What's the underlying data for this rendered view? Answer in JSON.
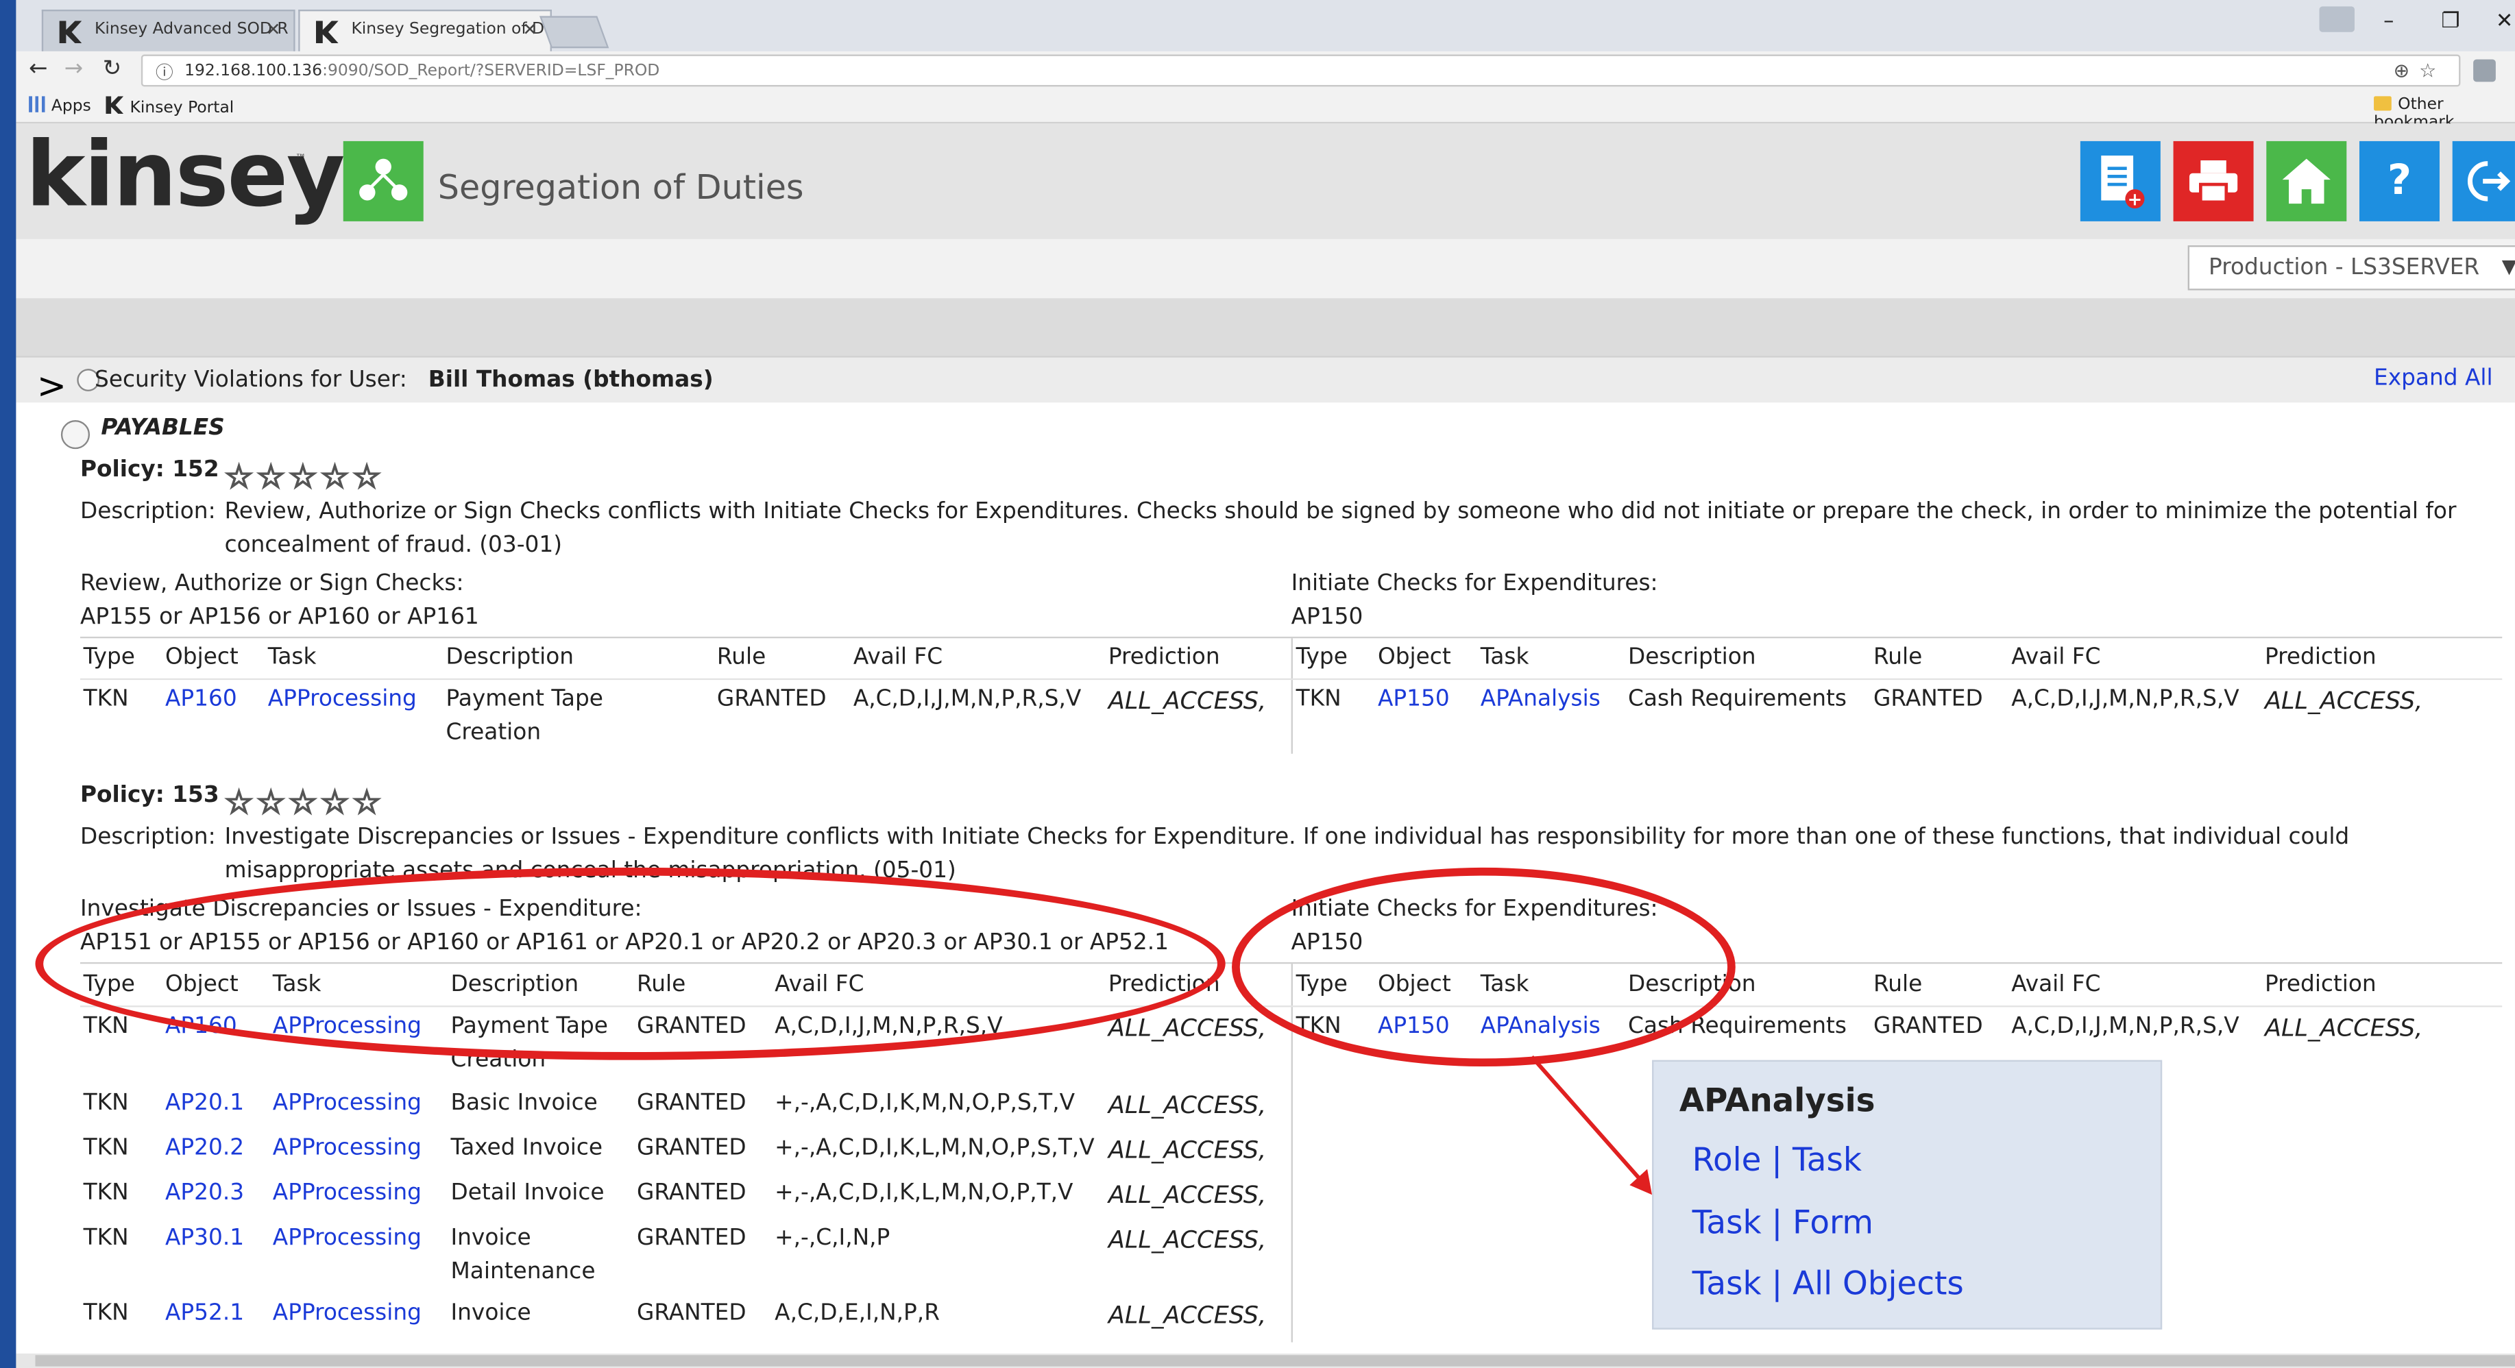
{
  "browser": {
    "tabs": [
      {
        "label": "Kinsey Advanced SOD R"
      },
      {
        "label": "Kinsey Segregation of D"
      }
    ],
    "url_host": "192.168.100.136",
    "url_path": ":9090/SOD_Report/?SERVERID=LSF_PROD",
    "bookmarks": [
      "Apps",
      "Kinsey Portal"
    ],
    "other_bookmarks": "Other bookmark"
  },
  "app": {
    "logo": "kinsey",
    "trademark": "™",
    "title": "Segregation of Duties",
    "environment": "Production - LS3SERVER",
    "toolbar": {
      "new": "+",
      "help": "?"
    },
    "colors": {
      "green": "#4bb84a",
      "blue": "#1e8fe0",
      "red": "#e02626",
      "highlight": "#e02020"
    }
  },
  "report": {
    "violations_label": "Security Violations for User:",
    "user": "Bill Thomas (bthomas)",
    "expand_all": "Expand All",
    "group": "PAYABLES",
    "desc_label": "Description:",
    "headers": [
      "Type",
      "Object",
      "Task",
      "Description",
      "Rule",
      "Avail FC",
      "Prediction"
    ],
    "policies": [
      {
        "label": "Policy: 152",
        "stars": "☆☆☆☆☆",
        "desc1": "Review, Authorize or Sign Checks conflicts with Initiate Checks for Expenditures. Checks should be signed by someone who did not initiate or prepare the check, in order to minimize the potential for",
        "desc2": "concealment of fraud. (03-01)",
        "left_func": "Review, Authorize or Sign Checks:",
        "left_objs": "AP155 or AP156 or AP160 or AP161",
        "right_func": "Initiate Checks for Expenditures:",
        "right_objs": "AP150",
        "left_rows": [
          {
            "type": "TKN",
            "object": "AP160",
            "task": "APProcessing",
            "desc1": "Payment Tape",
            "desc2": "Creation",
            "rule": "GRANTED",
            "fc": "A,C,D,I,J,M,N,P,R,S,V",
            "pred": "ALL_ACCESS,"
          }
        ],
        "right_rows": [
          {
            "type": "TKN",
            "object": "AP150",
            "task": "APAnalysis",
            "desc1": "Cash Requirements",
            "rule": "GRANTED",
            "fc": "A,C,D,I,J,M,N,P,R,S,V",
            "pred": "ALL_ACCESS,"
          }
        ]
      },
      {
        "label": "Policy: 153",
        "stars": "☆☆☆☆☆",
        "desc1": "Investigate Discrepancies or Issues - Expenditure conflicts with Initiate Checks for Expenditure. If one individual has responsibility for more than one of these functions, that individual could",
        "desc2": "misappropriate assets and conceal the misappropriation. (05-01)",
        "left_func": "Investigate Discrepancies or Issues - Expenditure:",
        "left_objs": "AP151 or AP155 or AP156 or AP160 or AP161 or AP20.1 or AP20.2 or AP20.3 or AP30.1 or AP52.1",
        "right_func": "Initiate Checks for Expenditures:",
        "right_objs": "AP150",
        "left_rows": [
          {
            "type": "TKN",
            "object": "AP160",
            "task": "APProcessing",
            "desc1": "Payment Tape",
            "desc2": "Creation",
            "rule": "GRANTED",
            "fc": "A,C,D,I,J,M,N,P,R,S,V",
            "pred": "ALL_ACCESS,"
          },
          {
            "type": "TKN",
            "object": "AP20.1",
            "task": "APProcessing",
            "desc1": "Basic Invoice",
            "rule": "GRANTED",
            "fc": "+,-,A,C,D,I,K,M,N,O,P,S,T,V",
            "pred": "ALL_ACCESS,"
          },
          {
            "type": "TKN",
            "object": "AP20.2",
            "task": "APProcessing",
            "desc1": "Taxed Invoice",
            "rule": "GRANTED",
            "fc": "+,-,A,C,D,I,K,L,M,N,O,P,S,T,V",
            "pred": "ALL_ACCESS,"
          },
          {
            "type": "TKN",
            "object": "AP20.3",
            "task": "APProcessing",
            "desc1": "Detail Invoice",
            "rule": "GRANTED",
            "fc": "+,-,A,C,D,I,K,L,M,N,O,P,T,V",
            "pred": "ALL_ACCESS,"
          },
          {
            "type": "TKN",
            "object": "AP30.1",
            "task": "APProcessing",
            "desc1": "Invoice",
            "desc2": "Maintenance",
            "rule": "GRANTED",
            "fc": "+,-,C,I,N,P",
            "pred": "ALL_ACCESS,"
          },
          {
            "type": "TKN",
            "object": "AP52.1",
            "task": "APProcessing",
            "desc1": "Invoice",
            "rule": "GRANTED",
            "fc": "A,C,D,E,I,N,P,R",
            "pred": "ALL_ACCESS,"
          }
        ],
        "right_rows": [
          {
            "type": "TKN",
            "object": "AP150",
            "task": "APAnalysis",
            "desc1": "Cash Requirements",
            "rule": "GRANTED",
            "fc": "A,C,D,I,J,M,N,P,R,S,V",
            "pred": "ALL_ACCESS,"
          }
        ]
      }
    ]
  },
  "popup": {
    "title": "APAnalysis",
    "links": [
      "Role | Task",
      "Task | Form",
      "Task | All Objects"
    ]
  }
}
